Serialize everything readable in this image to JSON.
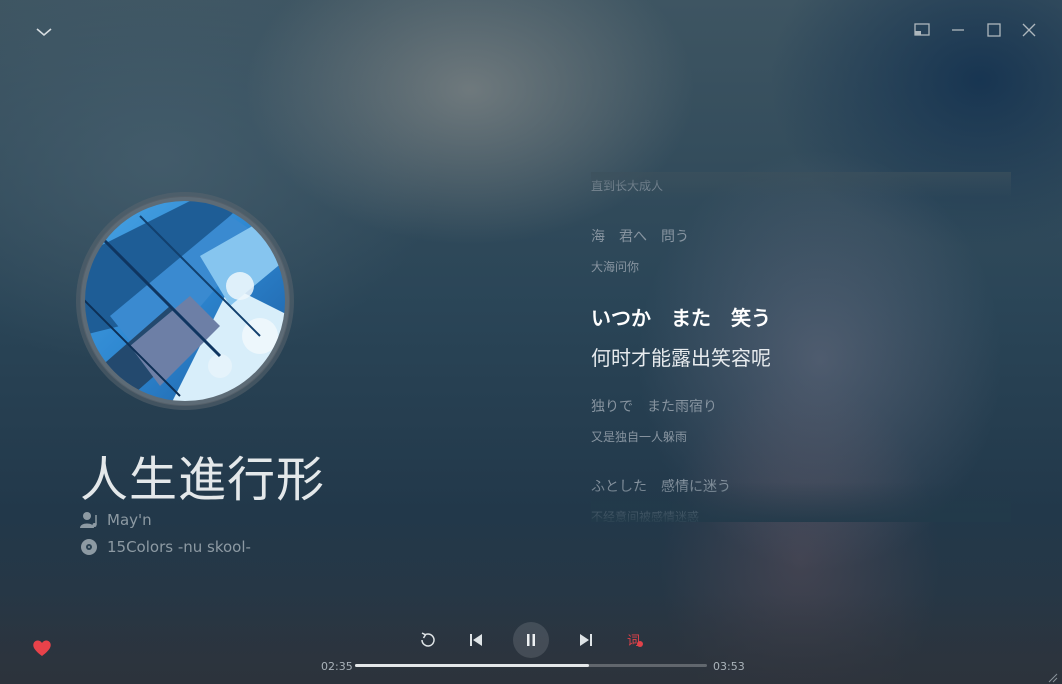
{
  "window": {
    "controls": [
      {
        "name": "mini-mode-icon"
      },
      {
        "name": "minimize-icon"
      },
      {
        "name": "maximize-icon"
      },
      {
        "name": "close-icon"
      }
    ]
  },
  "song": {
    "title": "人生進行形",
    "artist": "May'n",
    "album": "15Colors -nu skool-",
    "artist_icon": "singer-icon",
    "album_icon": "album-disc-icon"
  },
  "lyrics": {
    "lines": [
      {
        "text": "直到长大成人",
        "kind": "cn"
      },
      {
        "text": "海　君へ　問う",
        "kind": "jp"
      },
      {
        "text": "大海问你",
        "kind": "cn"
      },
      {
        "text": "いつか　また　笑う",
        "kind": "cur-jp"
      },
      {
        "text": "何时才能露出笑容呢",
        "kind": "cur-cn"
      },
      {
        "text": "独りで　また雨宿り",
        "kind": "jp"
      },
      {
        "text": "又是独自一人躲雨",
        "kind": "cn"
      },
      {
        "text": "ふとした　感情に迷う",
        "kind": "jp"
      },
      {
        "text": "不经意间被感情迷惑",
        "kind": "cn"
      }
    ]
  },
  "player": {
    "current_time": "02:35",
    "total_time": "03:53",
    "progress_fraction": 0.665,
    "liked": true,
    "state": "playing",
    "icons": {
      "like": "heart-icon",
      "mode": "repeat-icon",
      "prev": "previous-icon",
      "play": "pause-icon",
      "next": "next-icon",
      "lyrics": "lyrics-toggle-icon"
    },
    "colors": {
      "like": "#e8424a",
      "lyrics_icon": "#e0424a"
    }
  }
}
